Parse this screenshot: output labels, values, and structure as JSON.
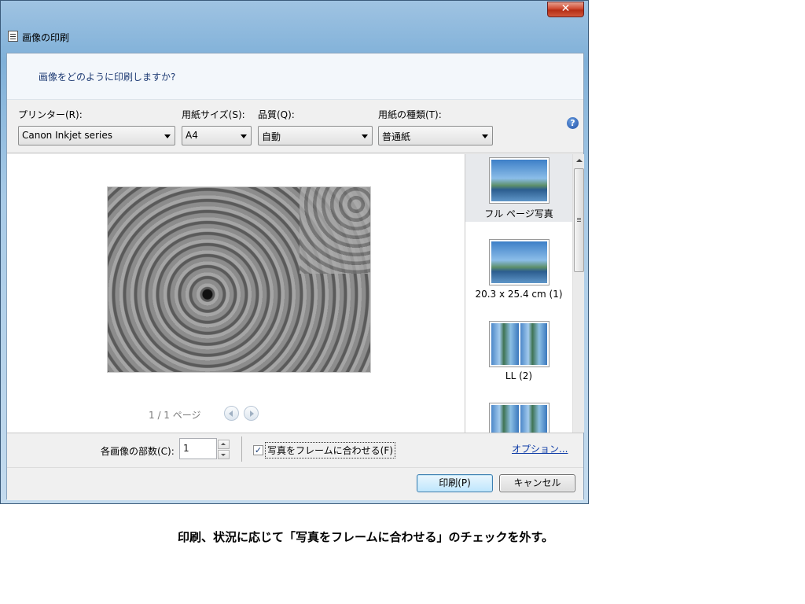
{
  "window": {
    "title": "画像の印刷",
    "close_symbol": "✕"
  },
  "question": "画像をどのように印刷しますか?",
  "options": {
    "printer": {
      "label": "プリンター(R):",
      "value": "Canon Inkjet           series"
    },
    "paper_size": {
      "label": "用紙サイズ(S):",
      "value": "A4"
    },
    "quality": {
      "label": "品質(Q):",
      "value": "自動"
    },
    "paper_type": {
      "label": "用紙の種類(T):",
      "value": "普通紙"
    },
    "help_symbol": "?"
  },
  "preview": {
    "page_indicator": "1 / 1 ページ",
    "image_icon": "flower-photo"
  },
  "layouts": [
    {
      "label": "フル ページ写真",
      "selected": true
    },
    {
      "label": "20.3 x 25.4 cm (1)",
      "selected": false
    },
    {
      "label": "LL (2)",
      "selected": false
    },
    {
      "label": "",
      "selected": false
    }
  ],
  "copies": {
    "label": "各画像の部数(C):",
    "value": "1"
  },
  "fit_to_frame": {
    "label": "写真をフレームに合わせる(F)",
    "checked": true,
    "mark": "✓"
  },
  "options_link": "オプション...",
  "buttons": {
    "print": "印刷(P)",
    "cancel": "キャンセル"
  },
  "caption": "印刷、状況に応じて「写真をフレームに合わせる」のチェックを外す。",
  "colors": {
    "link": "#0c3aa6",
    "question_text": "#1e3b74",
    "close_button": "#cf4a31"
  }
}
